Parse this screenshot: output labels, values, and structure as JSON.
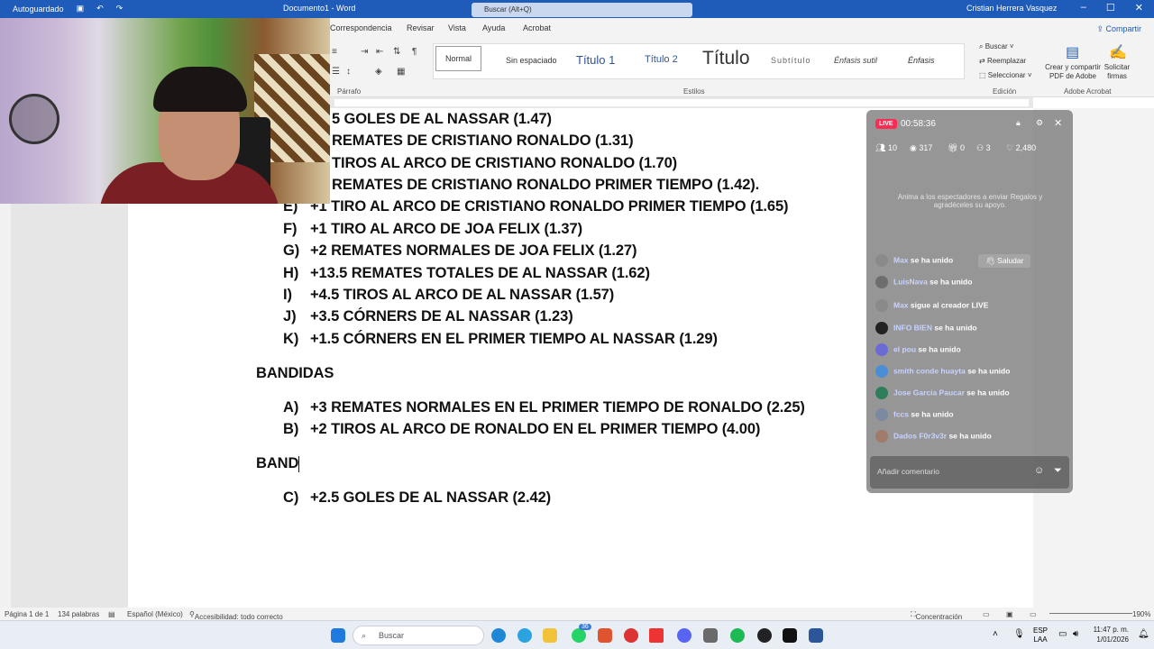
{
  "titlebar": {
    "autosave": "Autoguardado",
    "doc_name": "Documento1 - Word",
    "search": "Buscar (Alt+Q)",
    "user": "Cristian Herrera Vasquez"
  },
  "tabs": [
    "Correspondencia",
    "Revisar",
    "Vista",
    "Ayuda",
    "Acrobat"
  ],
  "share_label": "Compartir",
  "ribbon": {
    "paragraph_label": "Párrafo",
    "styles_label": "Estilos",
    "edit_label": "Edición",
    "adobe_label": "Adobe Acrobat",
    "styles": [
      "Normal",
      "Sin espaciado",
      "Título 1",
      "Título 2",
      "Título",
      "Subtítulo",
      "Énfasis sutil",
      "Énfasis"
    ],
    "edit_items": [
      "Buscar",
      "Reemplazar",
      "Seleccionar"
    ],
    "adobe_items": [
      "Crear y compartir PDF de Adobe",
      "Solicitar firmas"
    ]
  },
  "document": {
    "lines_top": [
      {
        "letter": "",
        "text": "5 GOLES DE AL NASSAR (1.47)"
      },
      {
        "letter": "",
        "text": "REMATES DE CRISTIANO RONALDO (1.31)"
      },
      {
        "letter": "",
        "text": "TIROS AL ARCO DE CRISTIANO RONALDO (1.70)"
      },
      {
        "letter": "",
        "text": "REMATES DE CRISTIANO RONALDO PRIMER TIEMPO (1.42)."
      },
      {
        "letter": "E)",
        "text": "+1 TIRO AL ARCO DE CRISTIANO RONALDO PRIMER TIEMPO (1.65)"
      },
      {
        "letter": "F)",
        "text": "+1 TIRO AL ARCO DE JOA FELIX (1.37)"
      },
      {
        "letter": "G)",
        "text": "+2 REMATES NORMALES DE JOA FELIX (1.27)"
      },
      {
        "letter": "H)",
        "text": "+13.5 REMATES TOTALES DE AL NASSAR (1.62)"
      },
      {
        "letter": "I)",
        "text": "+4.5 TIROS AL ARCO DE AL NASSAR (1.57)"
      },
      {
        "letter": "J)",
        "text": "+3.5 CÓRNERS DE AL NASSAR (1.23)"
      },
      {
        "letter": "K)",
        "text": "+1.5 CÓRNERS EN EL PRIMER TIEMPO AL NASSAR (1.29)"
      }
    ],
    "heading1": "BANDIDAS",
    "bandidas": [
      {
        "letter": "A)",
        "text": "+3 REMATES NORMALES EN EL PRIMER TIEMPO DE RONALDO (2.25)"
      },
      {
        "letter": "B)",
        "text": "+2 TIROS AL ARCO DE RONALDO EN EL PRIMER TIEMPO (4.00)"
      }
    ],
    "heading2": "BAND",
    "last": {
      "letter": "C)",
      "text": "+2.5 GOLES DE AL NASSAR (2.42)"
    }
  },
  "status": {
    "page": "Página 1 de 1",
    "words": "134 palabras",
    "lang": "Español (México)",
    "access": "Accesibilidad: todo correcto",
    "focus": "Concentración",
    "zoom": "190%"
  },
  "taskbar": {
    "search": "Buscar",
    "lang1": "ESP",
    "lang2": "LAA",
    "time": "11:47 p. m.",
    "date": "1/01/2026",
    "badge": "36"
  },
  "live": {
    "badge": "LIVE",
    "timer": "00:58:36",
    "stats": [
      "10",
      "317",
      "0",
      "3",
      "2,480"
    ],
    "hint": "Anima a los espectadores a enviar Regalos y agradéceles su apoyo.",
    "greet": "Saludar",
    "messages": [
      {
        "name": "Max",
        "text": "se ha unido"
      },
      {
        "name": "LuisNava",
        "text": "se ha unido"
      },
      {
        "name": "Max",
        "text": "sigue al creador LIVE"
      },
      {
        "name": "INFO BIEN",
        "text": "se ha unido"
      },
      {
        "name": "el pou",
        "text": "se ha unido"
      },
      {
        "name": "smith conde huayta",
        "text": "se ha unido"
      },
      {
        "name": "Jose Garcia Paucar",
        "text": "se ha unido"
      },
      {
        "name": "fccs",
        "text": "se ha unido"
      },
      {
        "name": "Dados F0r3v3r",
        "text": "se ha unido"
      }
    ],
    "comment_placeholder": "Añadir comentario"
  }
}
